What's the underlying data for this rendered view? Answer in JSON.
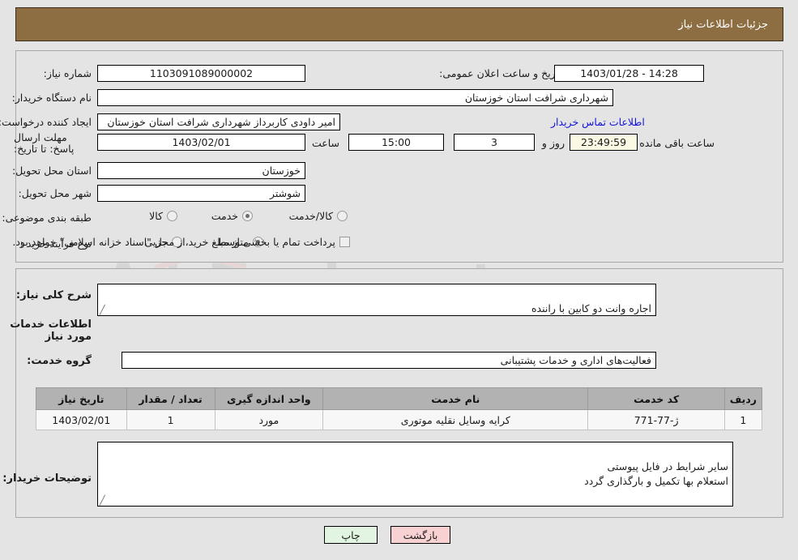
{
  "header": {
    "title": "جزئیات اطلاعات نیاز"
  },
  "top": {
    "need_number_label": "شماره نیاز:",
    "need_number_value": "1103091089000002",
    "announce_label": "تاریخ و ساعت اعلان عمومی:",
    "announce_value": "14:28 - 1403/01/28",
    "buyer_org_label": "نام دستگاه خریدار:",
    "buyer_org_value": "شهرداری شرافت استان خوزستان",
    "creator_label": "ایجاد کننده درخواست:",
    "creator_value": "امیر داودی کاربرداز شهرداری شرافت استان خوزستان",
    "contact_link": "اطلاعات تماس خریدار",
    "deadline_label": "مهلت ارسال پاسخ: تا تاریخ:",
    "deadline_date": "1403/02/01",
    "hour_label": "ساعت",
    "hour_value": "15:00",
    "days_value": "3",
    "days_unit": "روز و",
    "countdown_value": "23:49:59",
    "countdown_suffix": "ساعت باقی مانده",
    "province_label": "استان محل تحویل:",
    "province_value": "خوزستان",
    "city_label": "شهر محل تحویل:",
    "city_value": "شوشتر",
    "category_label": "طبقه بندی موضوعی:",
    "category_options": [
      {
        "label": "کالا",
        "selected": false
      },
      {
        "label": "خدمت",
        "selected": true
      },
      {
        "label": "کالا/خدمت",
        "selected": false
      }
    ],
    "process_label": "نوع فرآیند خرید :",
    "process_options": [
      {
        "label": "جزیی",
        "selected": false
      },
      {
        "label": "متوسط",
        "selected": true
      }
    ],
    "treasury_checkbox_checked": false,
    "treasury_note": "پرداخت تمام یا بخشی از مبلغ خرید،از محل \"اسناد خزانه اسلامی\" خواهد بود."
  },
  "bottom": {
    "general_desc_label": "شرح کلی نیاز:",
    "general_desc_value": "اجاره وانت دو کابین با راننده",
    "services_section_title": "اطلاعات خدمات مورد نیاز",
    "service_group_label": "گروه خدمت:",
    "service_group_value": "فعالیت‌های اداری و خدمات پشتیبانی",
    "table": {
      "columns": [
        "ردیف",
        "کد خدمت",
        "نام خدمت",
        "واحد اندازه گیری",
        "تعداد / مقدار",
        "تاریخ نیاز"
      ],
      "rows": [
        [
          "1",
          "ژ-77-771",
          "کرایه وسایل نقلیه موتوری",
          "مورد",
          "1",
          "1403/02/01"
        ]
      ]
    },
    "buyer_notes_label": "توضیحات خریدار:",
    "buyer_notes_value": "سایر شرایط در  فایل پیوستی\nاستعلام بها تکمیل و بارگذاری گردد"
  },
  "footer": {
    "back_label": "بازگشت",
    "print_label": "چاپ"
  },
  "watermark": {
    "text": "AriaTender.net"
  },
  "colors": {
    "header_bg": "#8d6e42",
    "panel_bg": "#e4e4e4",
    "link": "#1313e0",
    "table_header_bg": "#b2b2b2",
    "timer_bg": "#fbf8e3",
    "back_btn_bg": "#f8d2d2",
    "print_btn_bg": "#e2f5e2"
  }
}
